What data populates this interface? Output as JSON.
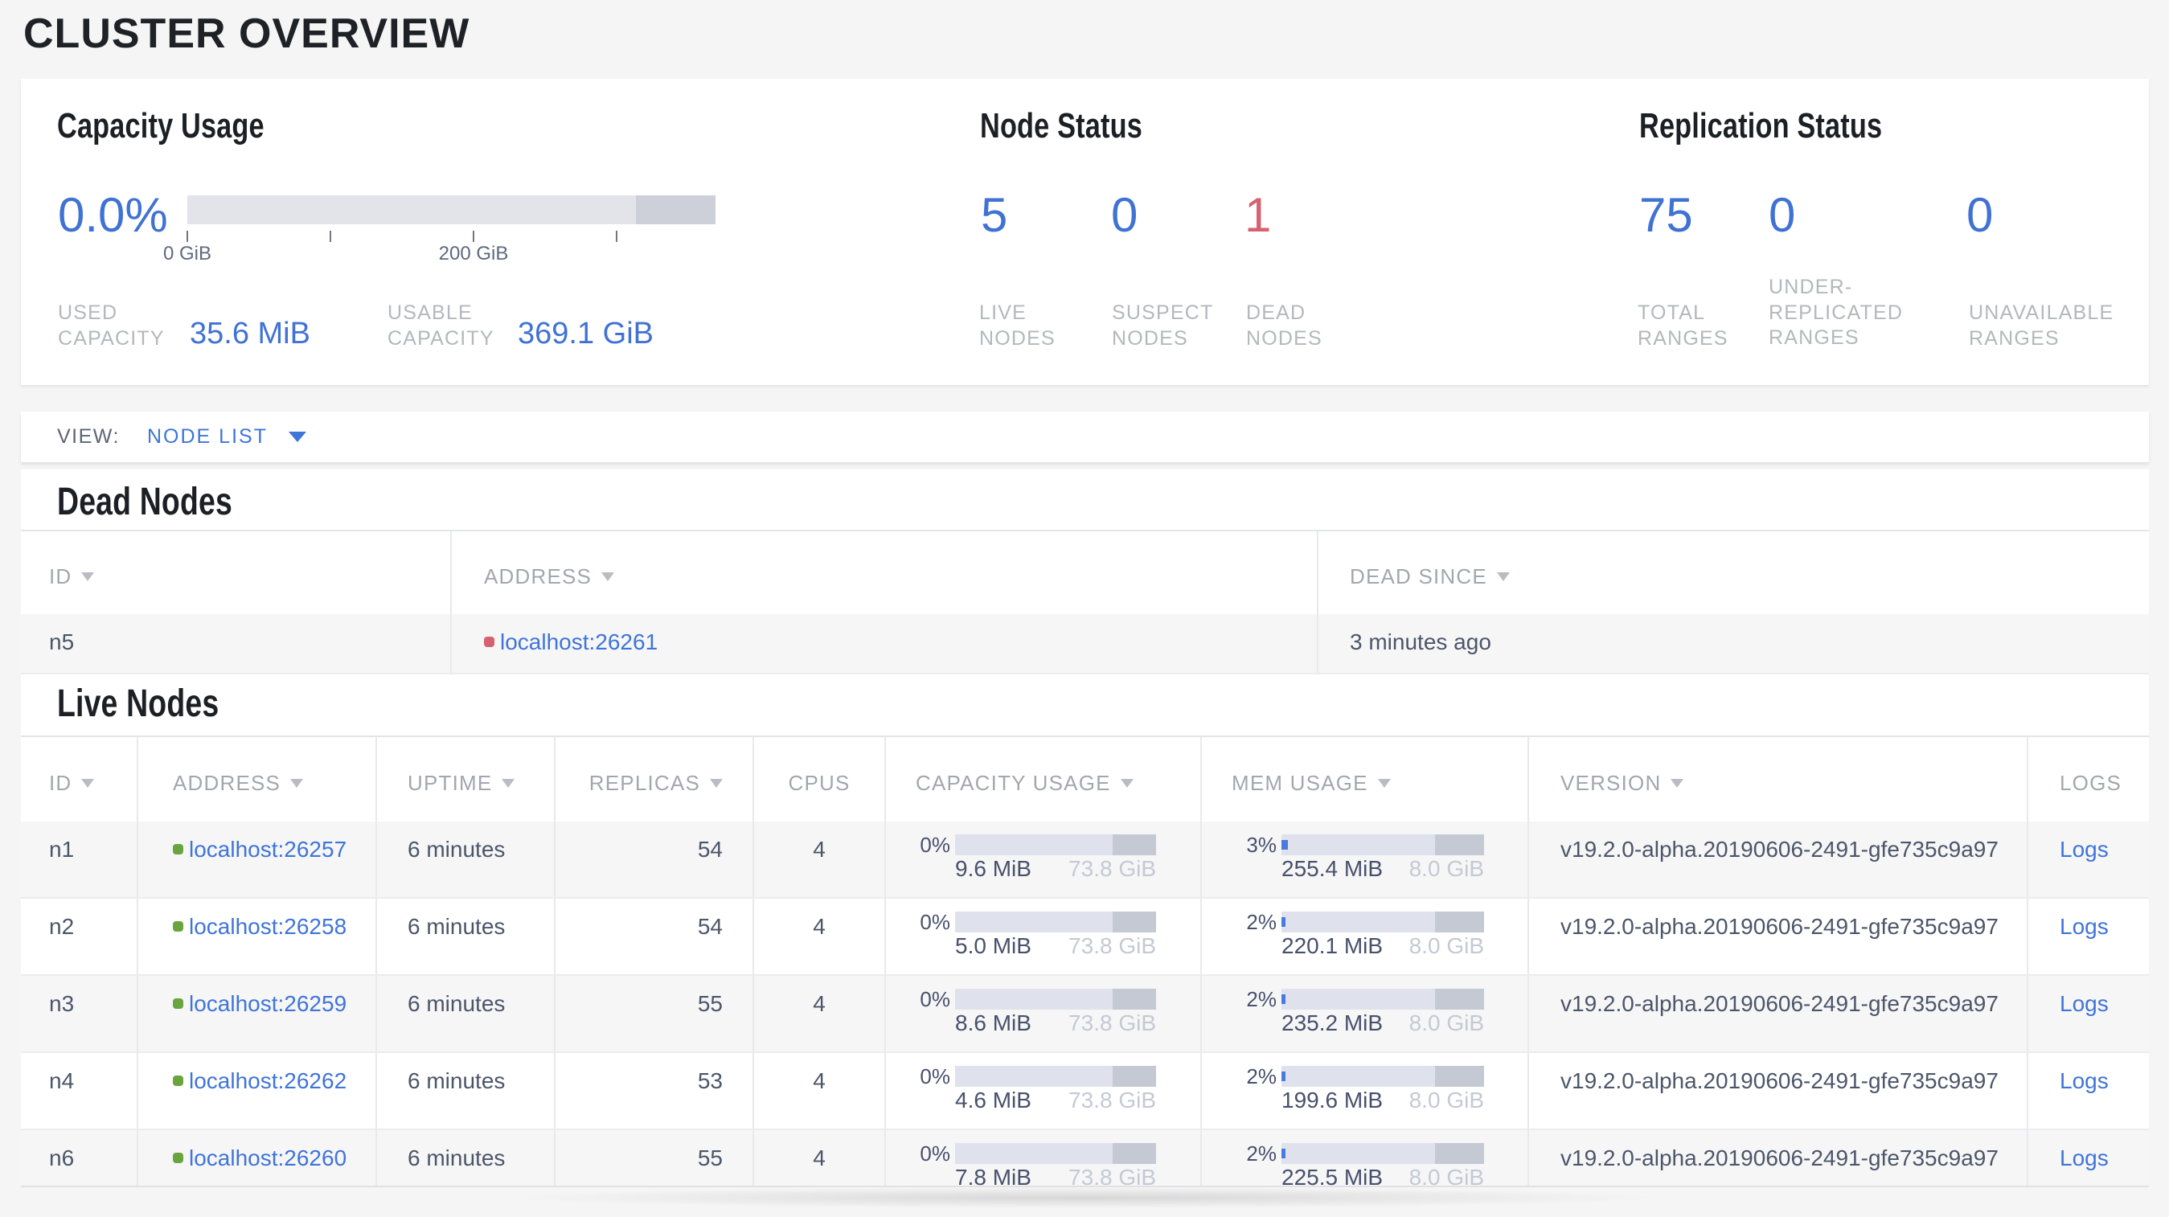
{
  "title": "CLUSTER OVERVIEW",
  "summary": {
    "capacity": {
      "heading": "Capacity Usage",
      "percent": "0.0%",
      "axis": {
        "ticks": [
          {
            "frac": 0.0,
            "label": "0 GiB"
          },
          {
            "frac": 0.271,
            "label": ""
          },
          {
            "frac": 0.542,
            "label": "200 GiB"
          },
          {
            "frac": 0.813,
            "label": ""
          }
        ],
        "other_fraction": 0.15
      },
      "stats": [
        {
          "label": "USED CAPACITY",
          "value": "35.6 MiB"
        },
        {
          "label": "USABLE CAPACITY",
          "value": "369.1 GiB"
        }
      ]
    },
    "node_status": {
      "heading": "Node Status",
      "metrics": [
        {
          "value": "5",
          "label": "LIVE NODES",
          "tone": "blue"
        },
        {
          "value": "0",
          "label": "SUSPECT NODES",
          "tone": "blue"
        },
        {
          "value": "1",
          "label": "DEAD NODES",
          "tone": "red"
        }
      ]
    },
    "replication": {
      "heading": "Replication Status",
      "metrics": [
        {
          "value": "75",
          "label": "TOTAL RANGES",
          "tone": "blue"
        },
        {
          "value": "0",
          "label": "UNDER-REPLICATED RANGES",
          "tone": "blue"
        },
        {
          "value": "0",
          "label": "UNAVAILABLE RANGES",
          "tone": "blue"
        }
      ]
    }
  },
  "view_bar": {
    "label": "VIEW:",
    "selected": "NODE LIST"
  },
  "dead_nodes": {
    "heading": "Dead Nodes",
    "columns": [
      {
        "label": "ID",
        "sortable": true
      },
      {
        "label": "ADDRESS",
        "sortable": true
      },
      {
        "label": "DEAD SINCE",
        "sortable": true
      }
    ],
    "rows": [
      {
        "id": "n5",
        "address": "localhost:26261",
        "status": "dead",
        "dead_since": "3 minutes ago"
      }
    ]
  },
  "live_nodes": {
    "heading": "Live Nodes",
    "columns": [
      {
        "label": "ID",
        "sortable": true
      },
      {
        "label": "ADDRESS",
        "sortable": true
      },
      {
        "label": "UPTIME",
        "sortable": true
      },
      {
        "label": "REPLICAS",
        "sortable": true
      },
      {
        "label": "CPUS",
        "sortable": false
      },
      {
        "label": "CAPACITY USAGE",
        "sortable": true
      },
      {
        "label": "MEM USAGE",
        "sortable": true
      },
      {
        "label": "VERSION",
        "sortable": true
      },
      {
        "label": "LOGS",
        "sortable": false
      }
    ],
    "capacity_bar": {
      "other_fraction": 0.218
    },
    "mem_bar": {
      "other_fraction": 0.244
    },
    "rows": [
      {
        "id": "n1",
        "address": "localhost:26257",
        "status": "live",
        "uptime": "6 minutes",
        "replicas": "54",
        "cpus": "4",
        "capacity": {
          "percent": "0%",
          "used": "9.6 MiB",
          "total": "73.8 GiB"
        },
        "memory": {
          "percent": "3%",
          "used": "255.4 MiB",
          "total": "8.0 GiB"
        },
        "version": "v19.2.0-alpha.20190606-2491-gfe735c9a97",
        "logs_label": "Logs"
      },
      {
        "id": "n2",
        "address": "localhost:26258",
        "status": "live",
        "uptime": "6 minutes",
        "replicas": "54",
        "cpus": "4",
        "capacity": {
          "percent": "0%",
          "used": "5.0 MiB",
          "total": "73.8 GiB"
        },
        "memory": {
          "percent": "2%",
          "used": "220.1 MiB",
          "total": "8.0 GiB"
        },
        "version": "v19.2.0-alpha.20190606-2491-gfe735c9a97",
        "logs_label": "Logs"
      },
      {
        "id": "n3",
        "address": "localhost:26259",
        "status": "live",
        "uptime": "6 minutes",
        "replicas": "55",
        "cpus": "4",
        "capacity": {
          "percent": "0%",
          "used": "8.6 MiB",
          "total": "73.8 GiB"
        },
        "memory": {
          "percent": "2%",
          "used": "235.2 MiB",
          "total": "8.0 GiB"
        },
        "version": "v19.2.0-alpha.20190606-2491-gfe735c9a97",
        "logs_label": "Logs"
      },
      {
        "id": "n4",
        "address": "localhost:26262",
        "status": "live",
        "uptime": "6 minutes",
        "replicas": "53",
        "cpus": "4",
        "capacity": {
          "percent": "0%",
          "used": "4.6 MiB",
          "total": "73.8 GiB"
        },
        "memory": {
          "percent": "2%",
          "used": "199.6 MiB",
          "total": "8.0 GiB"
        },
        "version": "v19.2.0-alpha.20190606-2491-gfe735c9a97",
        "logs_label": "Logs"
      },
      {
        "id": "n6",
        "address": "localhost:26260",
        "status": "live",
        "uptime": "6 minutes",
        "replicas": "55",
        "cpus": "4",
        "capacity": {
          "percent": "0%",
          "used": "7.8 MiB",
          "total": "73.8 GiB"
        },
        "memory": {
          "percent": "2%",
          "used": "225.5 MiB",
          "total": "8.0 GiB"
        },
        "version": "v19.2.0-alpha.20190606-2491-gfe735c9a97",
        "logs_label": "Logs"
      }
    ]
  }
}
